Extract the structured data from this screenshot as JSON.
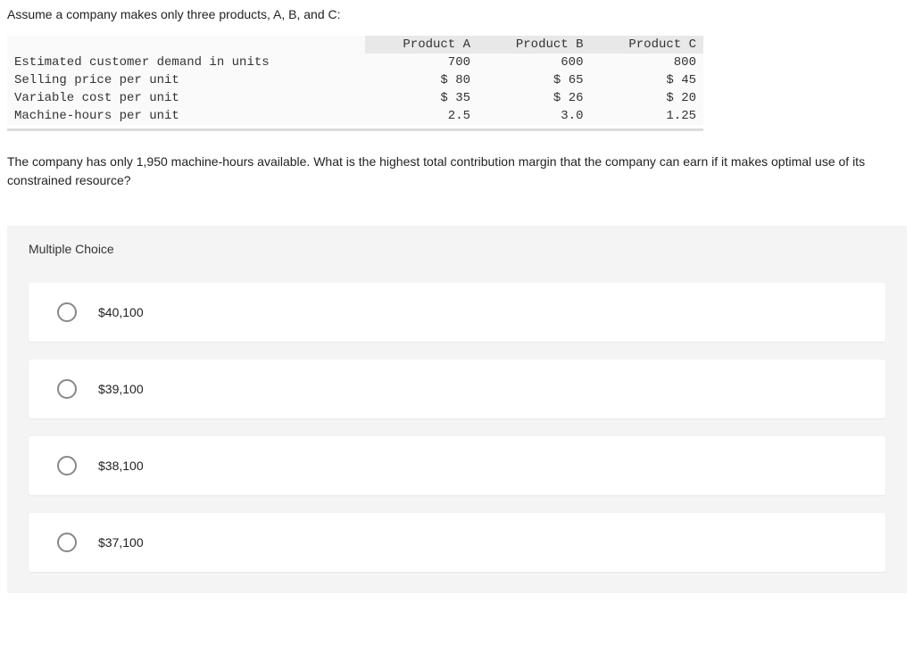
{
  "intro": "Assume a company makes only three products, A, B, and C:",
  "table": {
    "headers": [
      "",
      "Product A",
      "Product B",
      "Product C"
    ],
    "rows": [
      {
        "label": "Estimated customer demand in units",
        "a": "700",
        "b": "600",
        "c": "800"
      },
      {
        "label": "Selling price per unit",
        "a": "$ 80",
        "b": "$ 65",
        "c": "$  45"
      },
      {
        "label": "Variable cost per unit",
        "a": "$ 35",
        "b": "$ 26",
        "c": "$  20"
      },
      {
        "label": "Machine-hours per unit",
        "a": "2.5",
        "b": "3.0",
        "c": "1.25"
      }
    ]
  },
  "question": "The company has only 1,950 machine-hours available. What is the highest total contribution margin that the company can earn if it makes optimal use of its constrained resource?",
  "mc_header": "Multiple Choice",
  "options": [
    {
      "text": "$40,100"
    },
    {
      "text": "$39,100"
    },
    {
      "text": "$38,100"
    },
    {
      "text": "$37,100"
    }
  ]
}
